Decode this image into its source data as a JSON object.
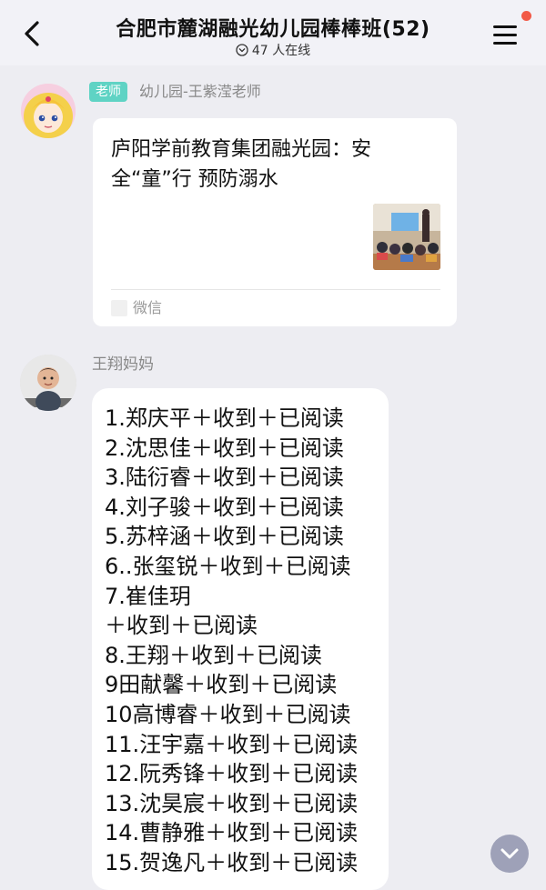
{
  "header": {
    "title": "合肥市麓湖融光幼儿园棒棒班(52)",
    "online": "47 人在线"
  },
  "teacher_message": {
    "tag": "老师",
    "sender": "幼儿园-王紫滢老师",
    "card_title": "庐阳学前教育集团融光园：安全“童”行 预防溺水",
    "source": "微信"
  },
  "mom_message": {
    "sender": "王翔妈妈",
    "lines": [
      "1.郑庆平＋收到＋已阅读",
      "2.沈思佳＋收到＋已阅读",
      "3.陆衍睿＋收到＋已阅读",
      "4.刘子骏＋收到＋已阅读",
      "5.苏梓涵＋收到＋已阅读",
      "6..张玺锐＋收到＋已阅读",
      "7.崔佳玥",
      "＋收到＋已阅读",
      "8.王翔＋收到＋已阅读",
      "9田献馨＋收到＋已阅读",
      "10高博睿＋收到＋已阅读",
      "11.汪宇嘉＋收到＋已阅读",
      "12.阮秀锋＋收到＋已阅读",
      "13.沈昊宸＋收到＋已阅读",
      "14.曹静雅＋收到＋已阅读",
      "15.贺逸凡＋收到＋已阅读"
    ]
  },
  "colors": {
    "teacher_tag": "#5fd3c4",
    "notification_dot": "#f25a47",
    "scroll_button": "#9ea1b8"
  }
}
